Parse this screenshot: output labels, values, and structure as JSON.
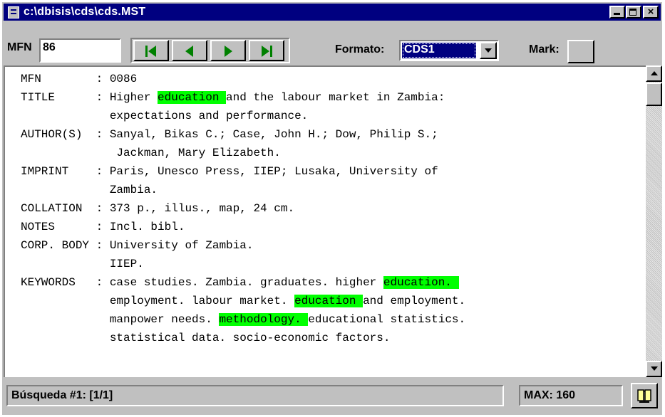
{
  "window": {
    "title": "c:\\dbisis\\cds\\cds.MST"
  },
  "toolbar": {
    "mfn_label": "MFN",
    "mfn_value": "86",
    "formato_label": "Formato:",
    "formato_value": "CDS1",
    "mark_label": "Mark:"
  },
  "record": {
    "lines": [
      [
        {
          "t": "MFN        : 0086"
        }
      ],
      [
        {
          "t": "TITLE      : Higher "
        },
        {
          "t": "education ",
          "h": 1
        },
        {
          "t": "and the labour market in Zambia:"
        }
      ],
      [
        {
          "t": "             expectations and performance."
        }
      ],
      [
        {
          "t": "AUTHOR(S)  : Sanyal, Bikas C.; Case, John H.; Dow, Philip S.;"
        }
      ],
      [
        {
          "t": "              Jackman, Mary Elizabeth."
        }
      ],
      [
        {
          "t": "IMPRINT    : Paris, Unesco Press, IIEP; Lusaka, University of"
        }
      ],
      [
        {
          "t": "             Zambia."
        }
      ],
      [
        {
          "t": "COLLATION  : 373 p., illus., map, 24 cm."
        }
      ],
      [
        {
          "t": "NOTES      : Incl. bibl."
        }
      ],
      [
        {
          "t": "CORP. BODY : University of Zambia."
        }
      ],
      [
        {
          "t": "             IIEP."
        }
      ],
      [
        {
          "t": "KEYWORDS   : case studies. Zambia. graduates. higher "
        },
        {
          "t": "education. ",
          "h": 1
        }
      ],
      [
        {
          "t": "             employment. labour market. "
        },
        {
          "t": "education ",
          "h": 1
        },
        {
          "t": "and employment."
        }
      ],
      [
        {
          "t": "             manpower needs. "
        },
        {
          "t": "methodology. ",
          "h": 1
        },
        {
          "t": "educational statistics."
        }
      ],
      [
        {
          "t": "             statistical data. socio-economic factors."
        }
      ]
    ]
  },
  "status": {
    "search_text": "Búsqueda #1: [1/1]",
    "max_text": "MAX: 160"
  },
  "colors": {
    "highlight": "#00ff00",
    "titlebar": "#000080",
    "face": "#c0c0c0"
  }
}
